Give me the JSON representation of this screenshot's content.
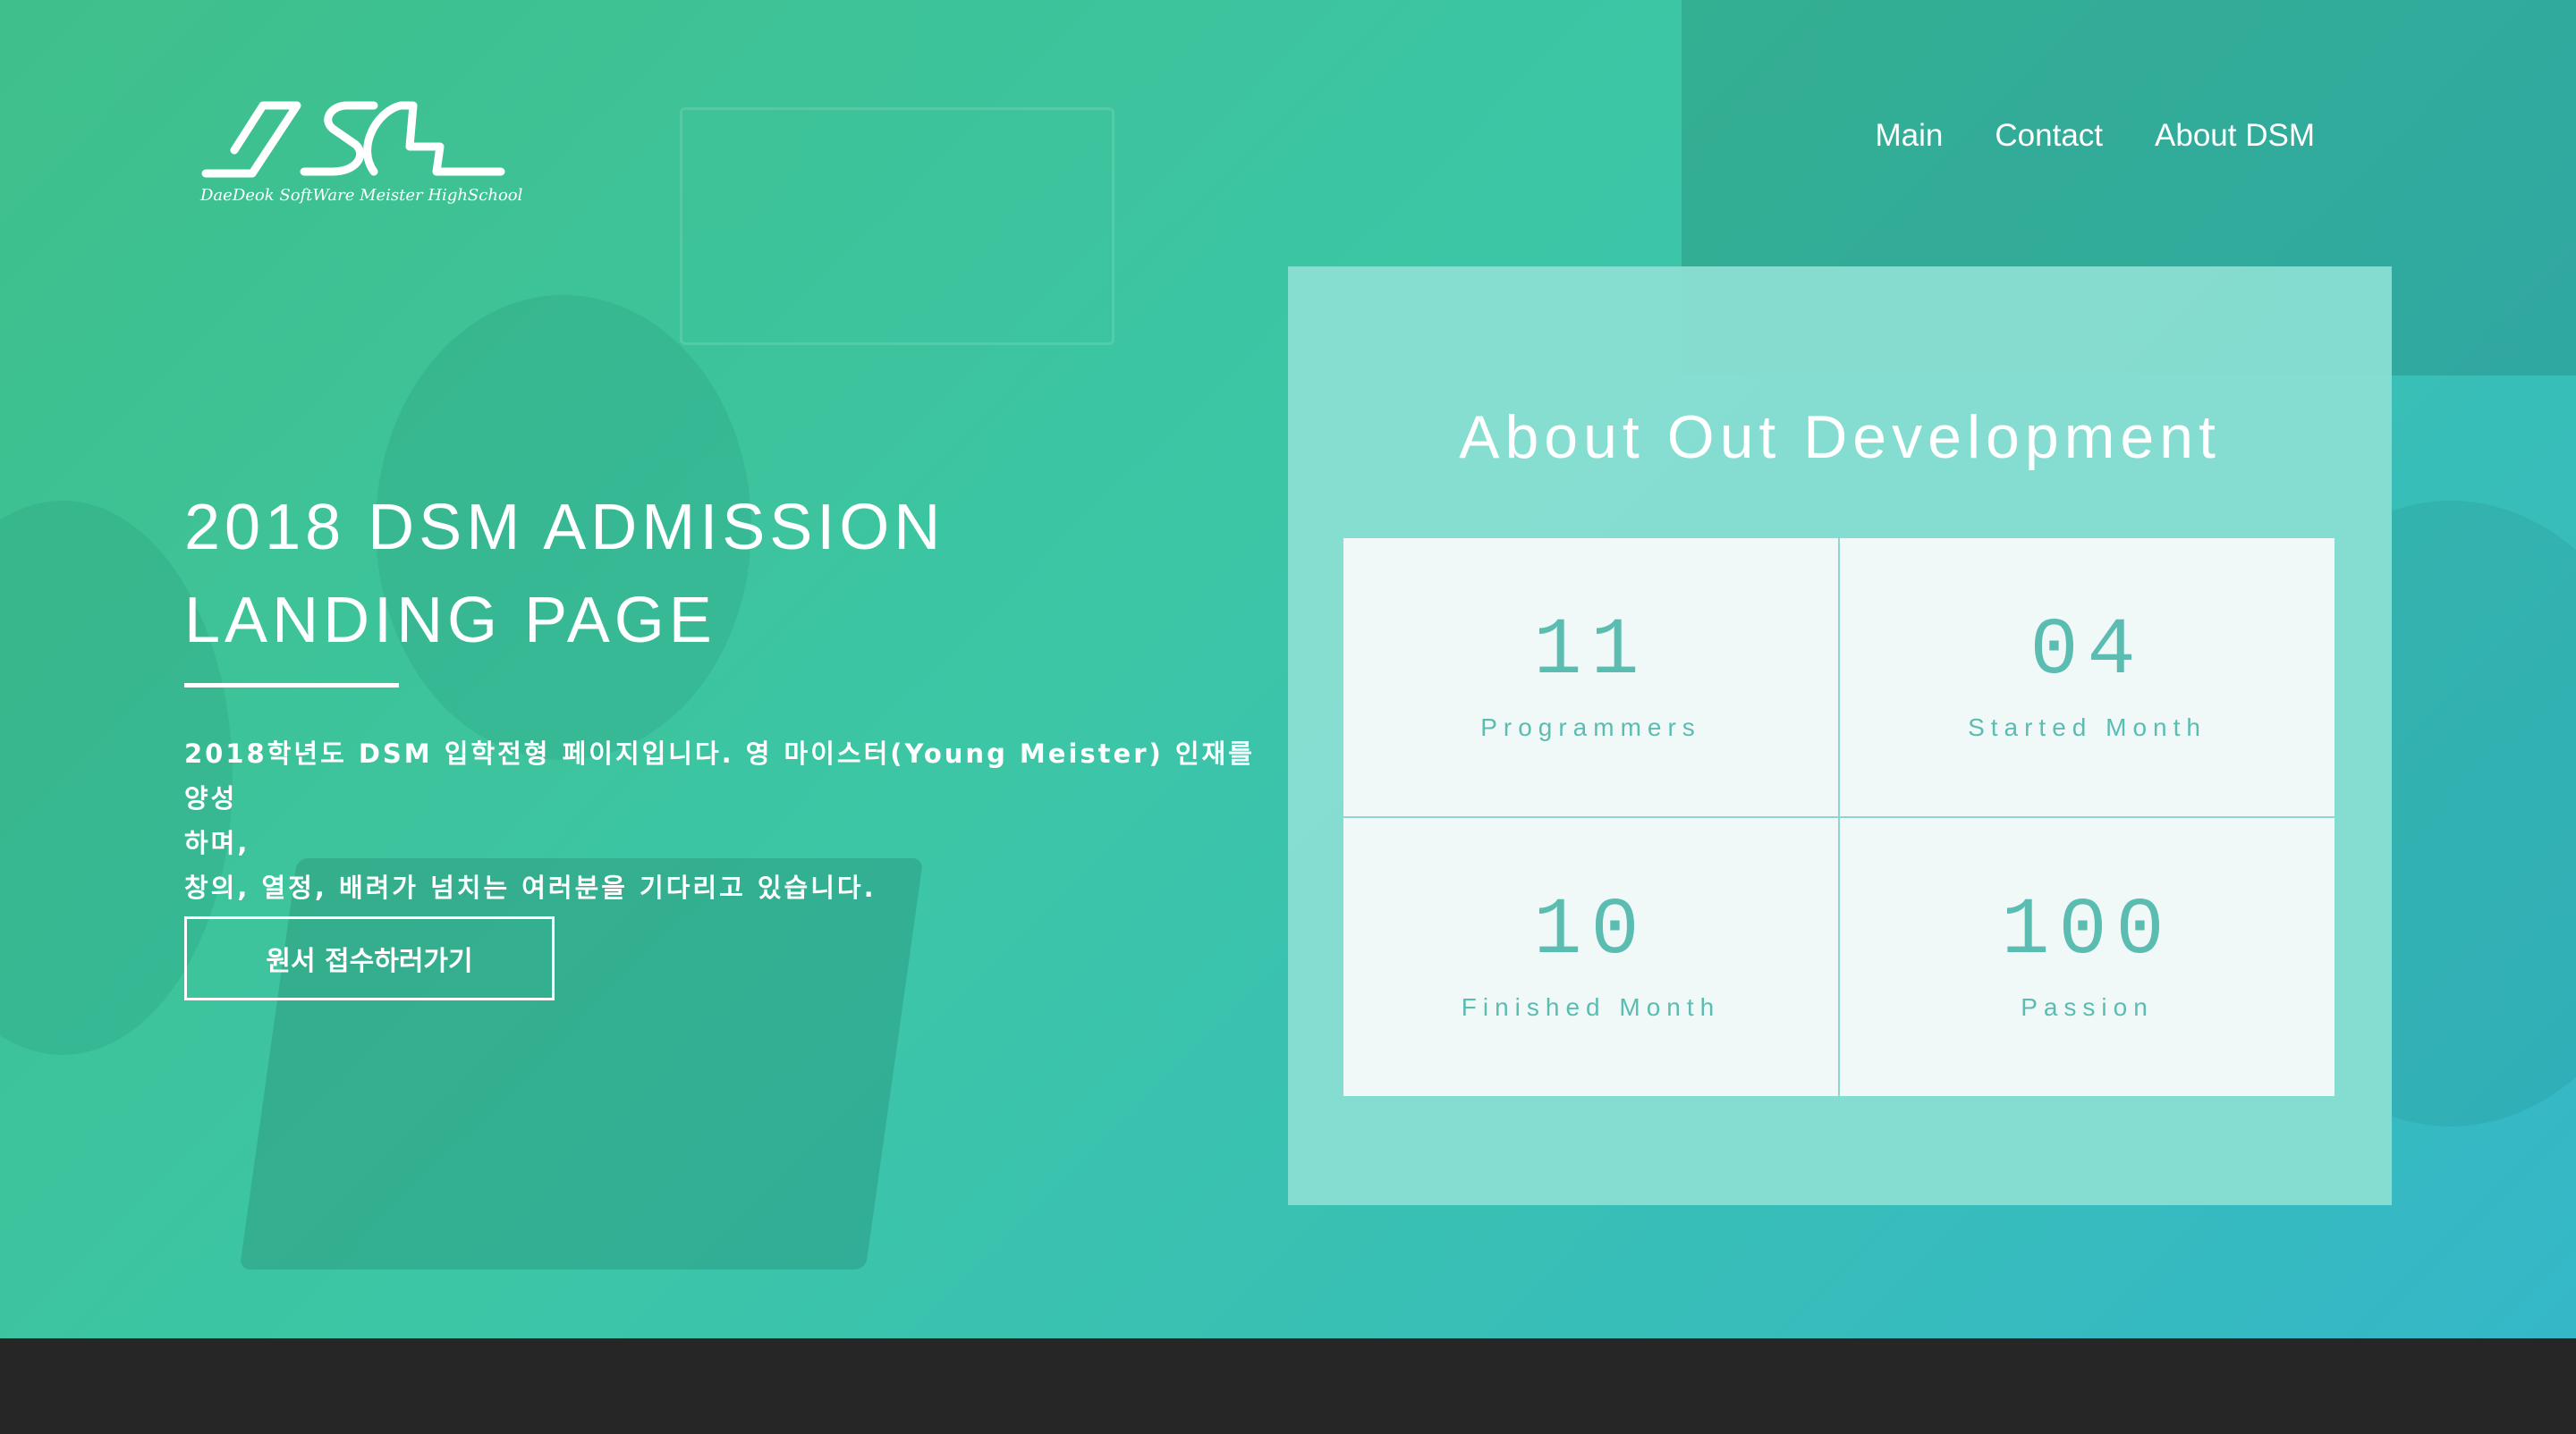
{
  "brand": {
    "tagline": "DaeDeok SoftWare Meister HighSchool"
  },
  "nav": {
    "items": [
      "Main",
      "Contact",
      "About DSM"
    ]
  },
  "hero": {
    "title_line1": "2018 DSM ADMISSION",
    "title_line2": "LANDING PAGE",
    "desc_line1": "2018학년도 DSM 입학전형 페이지입니다. 영 마이스터(Young Meister) 인재를 양성",
    "desc_line2": "하며,",
    "desc_line3": "창의, 열정, 배려가 넘치는 여러분을 기다리고 있습니다.",
    "button_label": "원서 접수하러가기"
  },
  "panel": {
    "title": "About Out Development",
    "stats": [
      {
        "value": "11",
        "label": "Programmers"
      },
      {
        "value": "04",
        "label": "Started Month"
      },
      {
        "value": "10",
        "label": "Finished Month"
      },
      {
        "value": "100",
        "label": "Passion"
      }
    ]
  },
  "colors": {
    "gradient_start": "#3fbf8a",
    "gradient_end": "#35b7c8",
    "panel_bg": "#8ce0d4",
    "stat_text": "#5bbcb2",
    "footer_bg": "#262626"
  }
}
